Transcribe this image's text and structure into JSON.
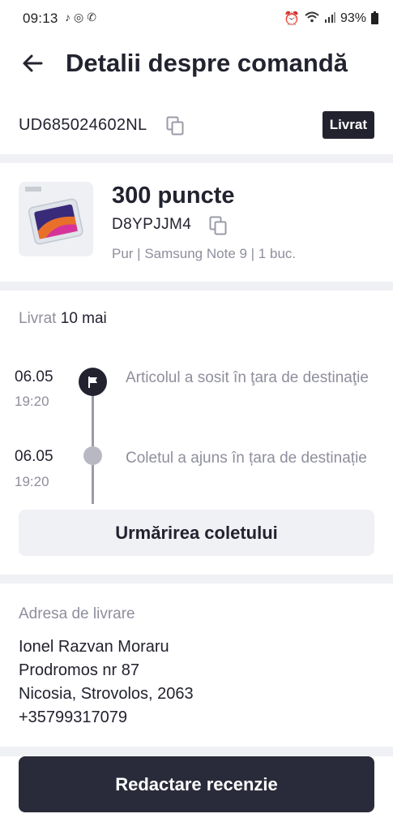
{
  "status_bar": {
    "time": "09:13",
    "battery": "93%"
  },
  "header": {
    "title": "Detalii despre comandă"
  },
  "order": {
    "number": "UD685024602NL",
    "status": "Livrat"
  },
  "product": {
    "title": "300 puncte",
    "code": "D8YPJJM4",
    "meta": "Pur | Samsung Note 9 | 1 buc."
  },
  "delivery": {
    "label": "Livrat",
    "date": "10 mai"
  },
  "timeline": [
    {
      "date": "06.05",
      "time": "19:20",
      "text": "Articolul a sosit în ţara de destinaţie"
    },
    {
      "date": "06.05",
      "time": "19:20",
      "text": "Coletul a ajuns în țara de destinație"
    }
  ],
  "track_button": "Urmărirea coletului",
  "address": {
    "label": "Adresa de livrare",
    "name": "Ionel  Razvan Moraru",
    "street": "Prodromos nr 87",
    "city": "Nicosia, Strovolos, 2063",
    "phone": "+35799317079"
  },
  "review_button": "Redactare recenzie"
}
